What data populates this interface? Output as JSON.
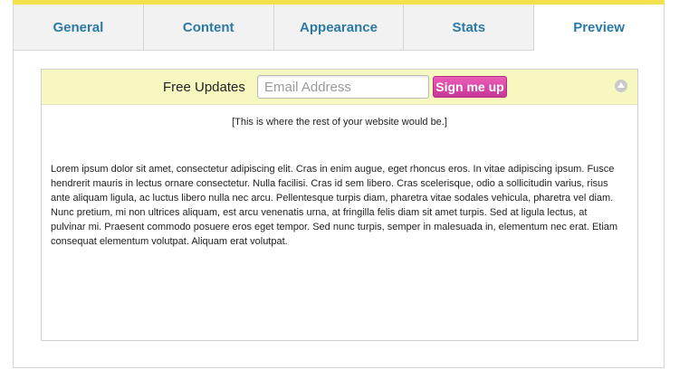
{
  "tabs": [
    {
      "label": "General",
      "active": false
    },
    {
      "label": "Content",
      "active": false
    },
    {
      "label": "Appearance",
      "active": false
    },
    {
      "label": "Stats",
      "active": false
    },
    {
      "label": "Preview",
      "active": true
    }
  ],
  "preview": {
    "bar": {
      "label": "Free Updates",
      "email_placeholder": "Email Address",
      "email_value": "",
      "button_label": "Sign me up",
      "collapse_icon": "chevron-up-circle-icon"
    },
    "placeholder_note": "[This is where the rest of your website would be.]",
    "body_text": "Lorem ipsum dolor sit amet, consectetur adipiscing elit. Cras in enim augue, eget rhoncus eros. In vitae adipiscing ipsum. Fusce hendrerit mauris in lectus ornare consectetur. Nulla facilisi. Cras id sem libero. Cras scelerisque, odio a sollicitudin varius, risus ante aliquam ligula, ac luctus libero nulla nec arcu. Pellentesque turpis diam, pharetra vitae sodales vehicula, pharetra vel diam. Nunc pretium, mi non ultrices aliquam, est arcu venenatis urna, at fringilla felis diam sit amet turpis. Sed at ligula lectus, at pulvinar mi. Praesent commodo posuere eros eget tempor. Sed nunc turpis, semper in malesuada in, elementum nec erat. Etiam consequat elementum volutpat. Aliquam erat volutpat."
  },
  "colors": {
    "tab_text": "#2b7aa6",
    "bar_background": "#f7f7c0",
    "button": "#d8459f",
    "top_accent": "#f4e04a"
  }
}
